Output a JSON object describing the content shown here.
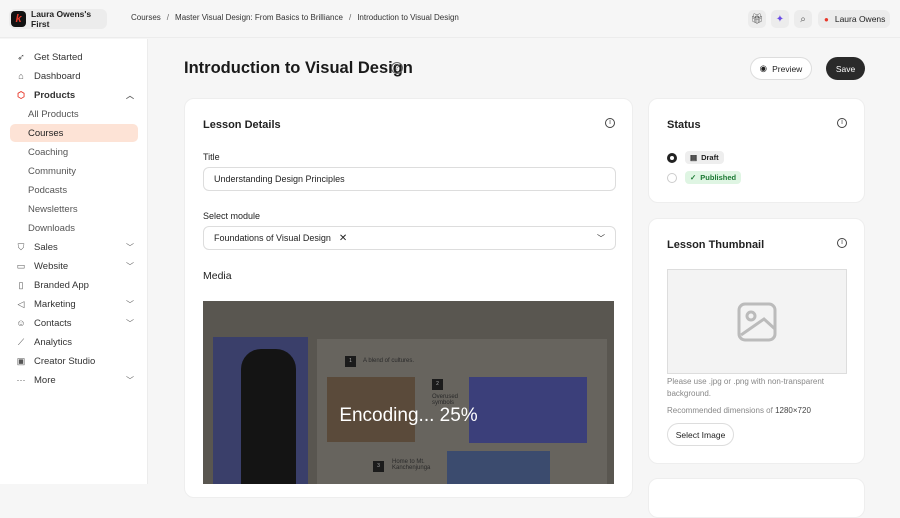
{
  "topbar": {
    "brand": "Laura Owens's First",
    "breadcrumbs": [
      "Courses",
      "Master Visual Design: From Basics to Brilliance",
      "Introduction to Visual Design"
    ],
    "separator": "/",
    "user": "Laura Owens"
  },
  "sidebar": {
    "items": [
      {
        "label": "Get Started",
        "icon": "rocket-icon"
      },
      {
        "label": "Dashboard",
        "icon": "home-icon"
      },
      {
        "label": "Products",
        "icon": "box-icon",
        "expanded": true
      },
      {
        "label": "All Products"
      },
      {
        "label": "Courses",
        "active": true
      },
      {
        "label": "Coaching"
      },
      {
        "label": "Community"
      },
      {
        "label": "Podcasts"
      },
      {
        "label": "Newsletters"
      },
      {
        "label": "Downloads"
      },
      {
        "label": "Sales",
        "icon": "tag-icon"
      },
      {
        "label": "Website",
        "icon": "monitor-icon"
      },
      {
        "label": "Branded App",
        "icon": "phone-icon"
      },
      {
        "label": "Marketing",
        "icon": "megaphone-icon"
      },
      {
        "label": "Contacts",
        "icon": "users-icon"
      },
      {
        "label": "Analytics",
        "icon": "chart-icon"
      },
      {
        "label": "Creator Studio",
        "icon": "video-icon"
      },
      {
        "label": "More",
        "icon": "more-icon"
      }
    ]
  },
  "page": {
    "title": "Introduction to Visual Design",
    "preview": "Preview",
    "save": "Save"
  },
  "lesson": {
    "heading": "Lesson Details",
    "title_label": "Title",
    "title_value": "Understanding Design Principles",
    "module_label": "Select module",
    "module_value": "Foundations of Visual Design",
    "media_label": "Media",
    "video": {
      "status": "Encoding... 25%",
      "progress": 25,
      "slide": {
        "n1": "1",
        "t1": "A blend of cultures.",
        "n2": "2",
        "t2": "Overused symbols",
        "n3": "3",
        "t3": "Home to Mt. Kanchenjunga"
      }
    }
  },
  "status": {
    "heading": "Status",
    "options": [
      {
        "label": "Draft",
        "selected": true
      },
      {
        "label": "Published",
        "selected": false
      }
    ]
  },
  "thumbnail": {
    "heading": "Lesson Thumbnail",
    "hint": "Please use .jpg or .png with non-transparent background.",
    "dims_prefix": "Recommended dimensions of",
    "dims": "1280×720",
    "button": "Select Image"
  },
  "colors": {
    "accent": "#fde3d6",
    "brand": "#e8392b",
    "published_bg": "#dff5e3",
    "published_fg": "#1e7a35"
  }
}
